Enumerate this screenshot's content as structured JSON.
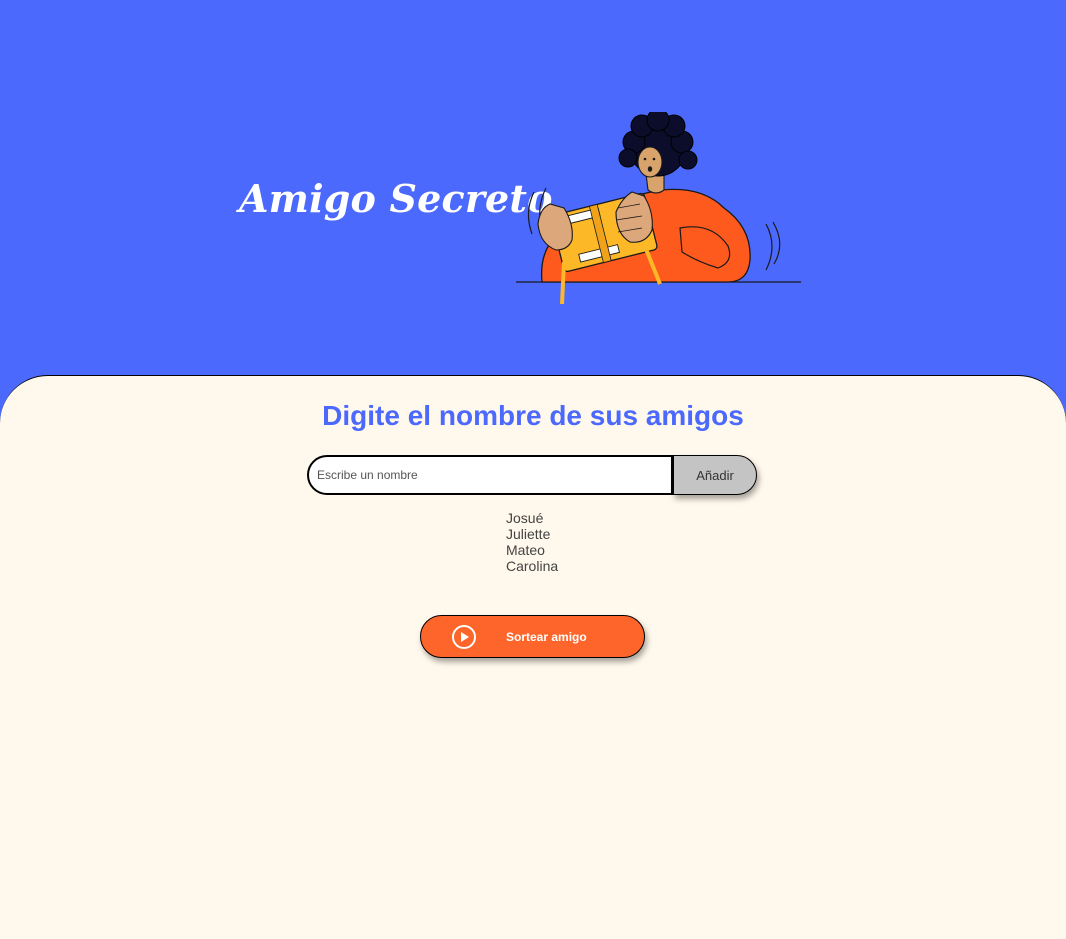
{
  "header": {
    "title": "Amigo Secreto",
    "illustration_icon": "person-holding-gift-box"
  },
  "main": {
    "subtitle": "Digite el nombre de sus amigos",
    "input": {
      "placeholder": "Escribe un nombre",
      "value": ""
    },
    "add_button_label": "Añadir",
    "friends": [
      "Josué",
      "Juliette",
      "Mateo",
      "Carolina"
    ],
    "draw_button": {
      "label": "Sortear amigo",
      "icon": "play-circle-icon"
    }
  },
  "colors": {
    "header_bg": "#4b69fd",
    "main_bg": "#fff8ec",
    "accent_blue": "#4b69fd",
    "accent_orange": "#fe652b",
    "button_gray": "#c4c4c4"
  }
}
